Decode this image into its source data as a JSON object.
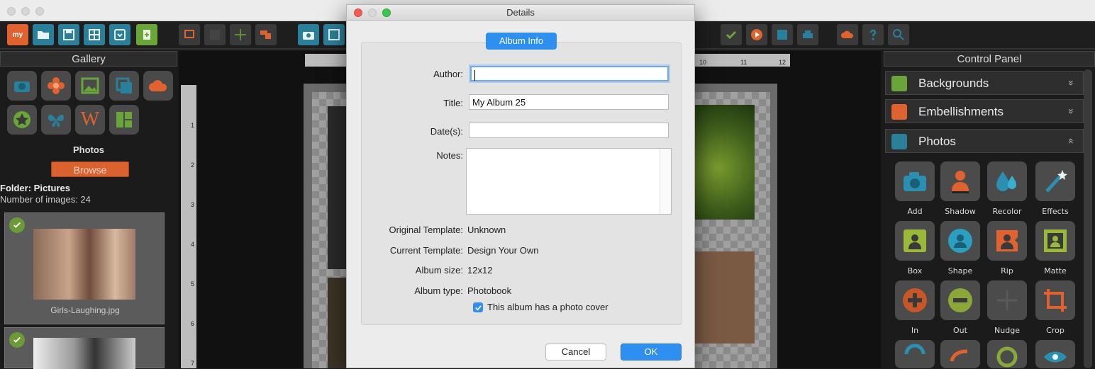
{
  "toolbar": {
    "icons": [
      "my-logo-icon",
      "open-folder-icon",
      "save-icon",
      "layout-icon",
      "export-icon",
      "add-page-icon",
      "page-icon",
      "grid-icon",
      "guides-icon",
      "arrange-icon",
      "camera-add-icon",
      "frame-icon",
      "approve-icon",
      "play-icon",
      "upload-icon",
      "print-icon",
      "cloud-icon",
      "help-icon",
      "zoom-icon"
    ],
    "logo_text": "my"
  },
  "gallery": {
    "title": "Gallery",
    "icons": [
      "camera-icon",
      "flower-icon",
      "image-icon",
      "layers-icon",
      "cloud-icon",
      "star-icon",
      "butterfly-icon",
      "word-art-icon",
      "layout-panels-icon"
    ],
    "word_art_letter": "W",
    "photos_title": "Photos",
    "browse_label": "Browse",
    "folder_label": "Folder: Pictures",
    "count_label": "Number of images: 24",
    "thumbnails": [
      {
        "caption": "Girls-Laughing.jpg"
      }
    ]
  },
  "rulers": {
    "top_right_numbers": [
      "10",
      "11",
      "12"
    ],
    "left_numbers": [
      "1",
      "2",
      "3",
      "4",
      "5",
      "6",
      "7"
    ]
  },
  "control_panel": {
    "title": "Control Panel",
    "sections": [
      {
        "label": "Backgrounds",
        "chevron": "»",
        "color": "#6aa53a"
      },
      {
        "label": "Embellishments",
        "chevron": "»",
        "color": "#e0622e"
      },
      {
        "label": "Photos",
        "chevron": "«",
        "color": "#2a7f9b"
      }
    ],
    "tools": [
      "Add",
      "Shadow",
      "Recolor",
      "Effects",
      "Box",
      "Shape",
      "Rip",
      "Matte",
      "In",
      "Out",
      "Nudge",
      "Crop"
    ]
  },
  "dialog": {
    "title": "Details",
    "tab_label": "Album Info",
    "author_label": "Author:",
    "author_value": "",
    "title_label": "Title:",
    "title_value": "My Album 25",
    "dates_label": "Date(s):",
    "dates_value": "",
    "notes_label": "Notes:",
    "original_template_label": "Original Template:",
    "original_template_value": "Unknown",
    "current_template_label": "Current Template:",
    "current_template_value": "Design Your Own",
    "album_size_label": "Album size:",
    "album_size_value": "12x12",
    "album_type_label": "Album type:",
    "album_type_value": "Photobook",
    "cover_checkbox_label": "This album has a photo cover",
    "cover_checkbox_checked": true,
    "cancel_label": "Cancel",
    "ok_label": "OK"
  },
  "colors": {
    "accent_blue": "#2f8ff0",
    "orange": "#e0622e",
    "teal": "#2a7f9b",
    "green": "#6aa53a"
  }
}
